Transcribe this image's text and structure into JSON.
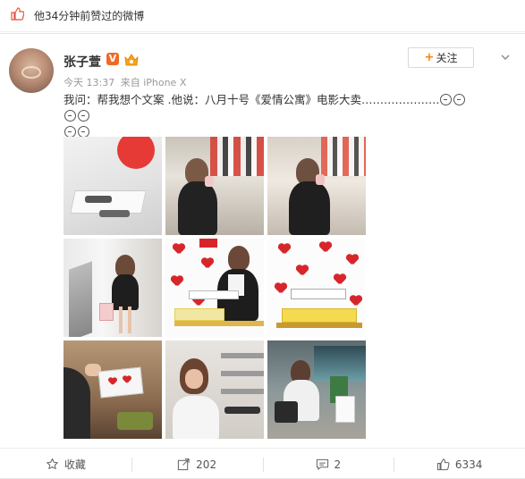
{
  "notice": {
    "text": "他34分钟前赞过的微博",
    "icon": "thumbs-up-icon"
  },
  "post": {
    "author": "张子萱",
    "vip_badge": "V",
    "follow_label": "关注",
    "timestamp": "今天 13:37",
    "source": "来自 iPhone X",
    "content": "我问：帮我想个文案 .他说：八月十号《爱情公寓》电影大卖…………………",
    "emoji_count": 6
  },
  "actions": [
    {
      "icon": "star-icon",
      "label": "收藏"
    },
    {
      "icon": "share-icon",
      "label": "202"
    },
    {
      "icon": "comment-icon",
      "label": "2"
    },
    {
      "icon": "thumbs-up-icon",
      "label": "6334"
    }
  ],
  "colors": {
    "accent": "#ff8200",
    "vip": "#f06a24",
    "heart_red": "#d7262b"
  }
}
